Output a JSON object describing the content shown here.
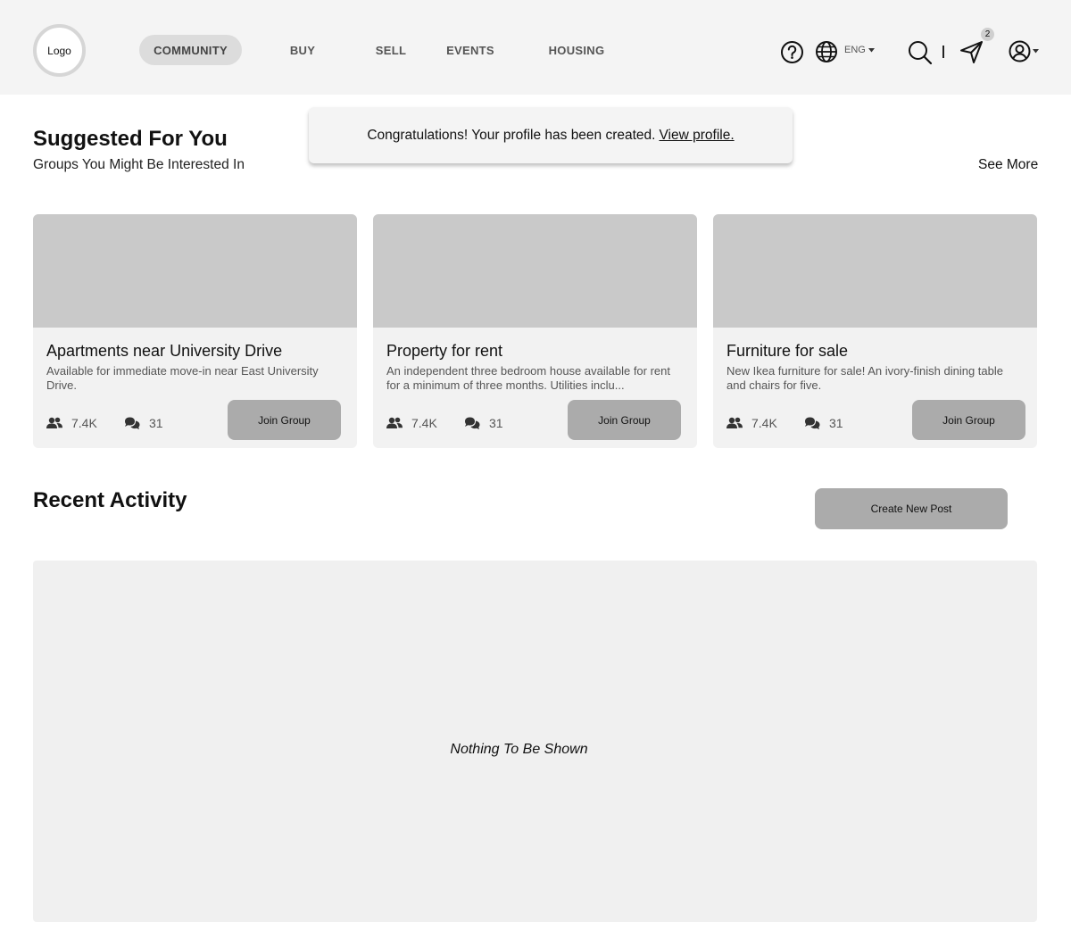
{
  "header": {
    "logo": "Logo",
    "nav": [
      {
        "label": "COMMUNITY",
        "active": true
      },
      {
        "label": "BUY",
        "active": false
      },
      {
        "label": "SELL",
        "active": false
      },
      {
        "label": "EVENTS",
        "active": false
      },
      {
        "label": "HOUSING",
        "active": false
      }
    ],
    "language": "ENG",
    "messages_badge": "2",
    "icons": [
      "help-icon",
      "globe-icon",
      "search-icon",
      "send-icon",
      "user-icon"
    ]
  },
  "toast": {
    "message": "Congratulations! Your profile has been created.",
    "link": "View profile."
  },
  "suggested": {
    "title": "Suggested For You",
    "subtitle": "Groups You Might Be Interested In",
    "see_more": "See More",
    "cards": [
      {
        "title": "Apartments near University Drive",
        "description": "Available for immediate move-in near East University Drive.",
        "members": "7.4K",
        "comments": "31",
        "button": "Join Group"
      },
      {
        "title": "Property for rent",
        "description": "An independent three bedroom house available for rent for a minimum of three months. Utilities inclu...",
        "members": "7.4K",
        "comments": "31",
        "button": "Join Group"
      },
      {
        "title": "Furniture for sale",
        "description": "New Ikea furniture for sale! An ivory-finish dining table and chairs for five.",
        "members": "7.4K",
        "comments": "31",
        "button": "Join Group"
      }
    ]
  },
  "recent": {
    "title": "Recent Activity",
    "create_button": "Create New Post",
    "empty_message": "Nothing To Be Shown"
  },
  "colors": {
    "header_bg": "#f4f4f4",
    "card_bg": "#f2f2f2",
    "image_placeholder": "#c9c9c9",
    "button_bg": "#ababab",
    "nav_active_bg": "#dcdcdc"
  }
}
